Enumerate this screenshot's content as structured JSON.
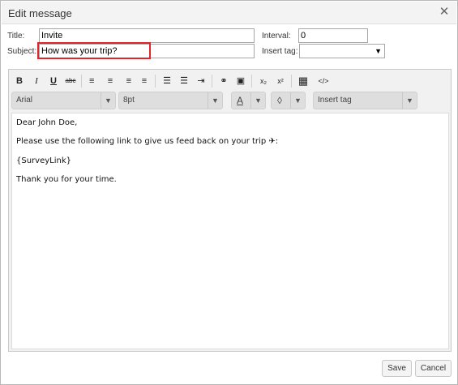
{
  "dialog": {
    "title": "Edit message",
    "close_glyph": "✕"
  },
  "form": {
    "title_label": "Title:",
    "title_value": "Invite",
    "subject_label": "Subject:",
    "subject_value": "How was your trip?",
    "interval_label": "Interval:",
    "interval_value": "0",
    "insert_tag_label": "Insert tag:",
    "insert_tag_value": ""
  },
  "toolbar": {
    "buttons": [
      {
        "name": "bold-button",
        "glyph": "B"
      },
      {
        "name": "italic-button",
        "glyph": "I"
      },
      {
        "name": "underline-button",
        "glyph": "U"
      },
      {
        "name": "strikethrough-button",
        "glyph": "abc"
      },
      {
        "name": "align-left-button",
        "glyph": "≡"
      },
      {
        "name": "align-center-button",
        "glyph": "≡"
      },
      {
        "name": "align-right-button",
        "glyph": "≡"
      },
      {
        "name": "justify-button",
        "glyph": "≡"
      },
      {
        "name": "bullet-list-button",
        "glyph": "☰"
      },
      {
        "name": "numbered-list-button",
        "glyph": "☰"
      },
      {
        "name": "indent-button",
        "glyph": "⇥"
      },
      {
        "name": "link-button",
        "glyph": "⚭"
      },
      {
        "name": "image-button",
        "glyph": "▣"
      },
      {
        "name": "subscript-button",
        "glyph": "x₂"
      },
      {
        "name": "superscript-button",
        "glyph": "x²"
      },
      {
        "name": "table-button",
        "glyph": "▦"
      },
      {
        "name": "source-code-button",
        "glyph": "</>"
      }
    ],
    "font_family": "Arial",
    "font_size": "8pt",
    "font_color_glyph": "A",
    "highlight_glyph": "◊",
    "insert_tag_placeholder": "Insert tag",
    "dropdown_arrow": "▼"
  },
  "body": {
    "line1": "Dear John Doe,",
    "line2": "Please use the following link to give us feed back on your trip ✈:",
    "line3": "{SurveyLink}",
    "line4": "Thank you for your time."
  },
  "footer": {
    "save_label": "Save",
    "cancel_label": "Cancel"
  }
}
